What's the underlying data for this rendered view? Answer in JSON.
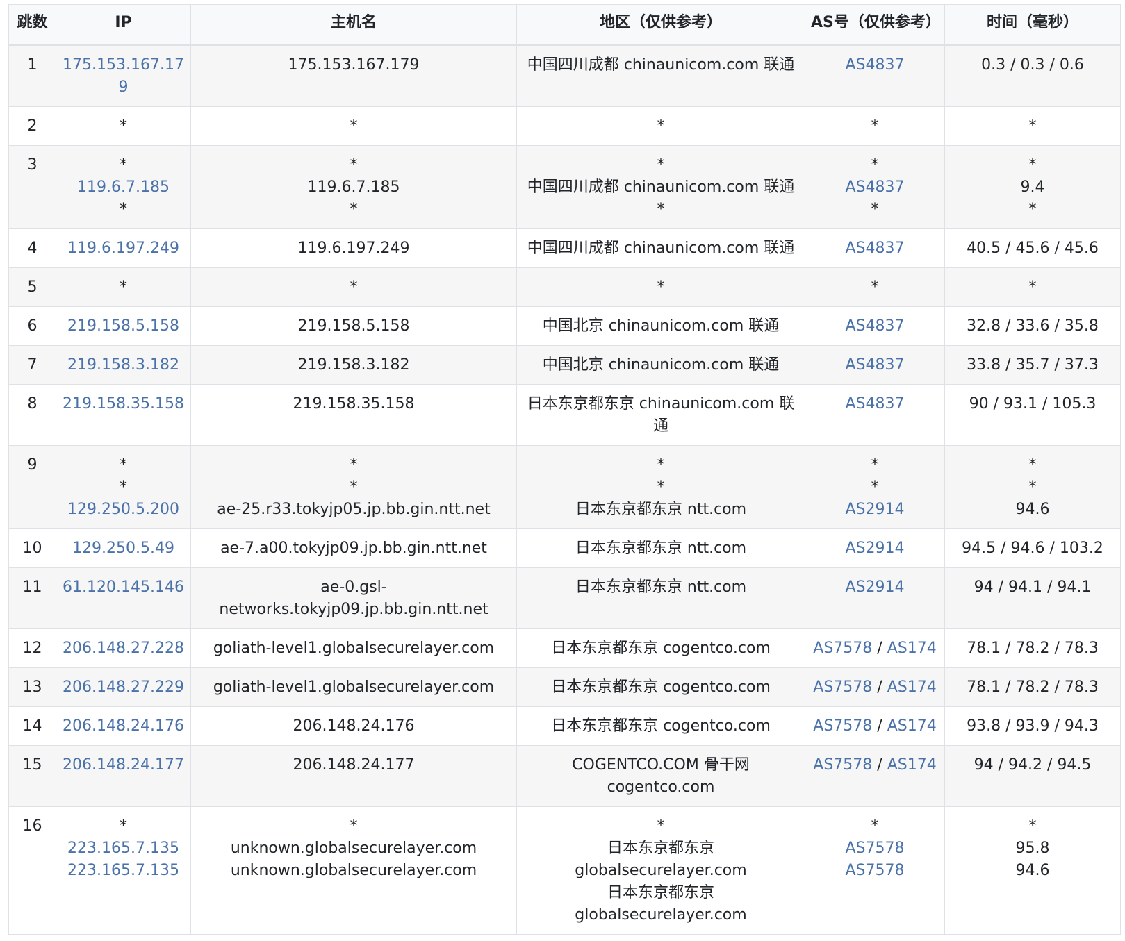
{
  "headers": {
    "hop": "跳数",
    "ip": "IP",
    "host": "主机名",
    "region": "地区（仅供参考）",
    "asn": "AS号（仅供参考）",
    "time": "时间（毫秒）"
  },
  "colors": {
    "link": "#4a72a9",
    "border": "#dee2e6",
    "stripe": "#f6f6f6"
  },
  "rows": [
    {
      "hop": "1",
      "ip": [
        "175.153.167.179"
      ],
      "host": [
        "175.153.167.179"
      ],
      "region": [
        "中国四川成都 chinaunicom.com 联通"
      ],
      "asn": [
        [
          "AS4837"
        ]
      ],
      "time": [
        "0.3 / 0.3 / 0.6"
      ]
    },
    {
      "hop": "2",
      "ip": [
        "*"
      ],
      "host": [
        "*"
      ],
      "region": [
        "*"
      ],
      "asn": [
        [
          "*"
        ]
      ],
      "time": [
        "*"
      ]
    },
    {
      "hop": "3",
      "ip": [
        "*",
        "119.6.7.185",
        "*"
      ],
      "host": [
        "*",
        "119.6.7.185",
        "*"
      ],
      "region": [
        "*",
        "中国四川成都 chinaunicom.com 联通",
        "*"
      ],
      "asn": [
        [
          "*"
        ],
        [
          "AS4837"
        ],
        [
          "*"
        ]
      ],
      "time": [
        "*",
        "9.4",
        "*"
      ]
    },
    {
      "hop": "4",
      "ip": [
        "119.6.197.249"
      ],
      "host": [
        "119.6.197.249"
      ],
      "region": [
        "中国四川成都 chinaunicom.com 联通"
      ],
      "asn": [
        [
          "AS4837"
        ]
      ],
      "time": [
        "40.5 / 45.6 / 45.6"
      ]
    },
    {
      "hop": "5",
      "ip": [
        "*"
      ],
      "host": [
        "*"
      ],
      "region": [
        "*"
      ],
      "asn": [
        [
          "*"
        ]
      ],
      "time": [
        "*"
      ]
    },
    {
      "hop": "6",
      "ip": [
        "219.158.5.158"
      ],
      "host": [
        "219.158.5.158"
      ],
      "region": [
        "中国北京 chinaunicom.com 联通"
      ],
      "asn": [
        [
          "AS4837"
        ]
      ],
      "time": [
        "32.8 / 33.6 / 35.8"
      ]
    },
    {
      "hop": "7",
      "ip": [
        "219.158.3.182"
      ],
      "host": [
        "219.158.3.182"
      ],
      "region": [
        "中国北京 chinaunicom.com 联通"
      ],
      "asn": [
        [
          "AS4837"
        ]
      ],
      "time": [
        "33.8 / 35.7 / 37.3"
      ]
    },
    {
      "hop": "8",
      "ip": [
        "219.158.35.158"
      ],
      "host": [
        "219.158.35.158"
      ],
      "region": [
        "日本东京都东京 chinaunicom.com 联通"
      ],
      "asn": [
        [
          "AS4837"
        ]
      ],
      "time": [
        "90 / 93.1 / 105.3"
      ]
    },
    {
      "hop": "9",
      "ip": [
        "*",
        "*",
        "129.250.5.200"
      ],
      "host": [
        "*",
        "*",
        "ae-25.r33.tokyjp05.jp.bb.gin.ntt.net"
      ],
      "region": [
        "*",
        "*",
        "日本东京都东京 ntt.com"
      ],
      "asn": [
        [
          "*"
        ],
        [
          "*"
        ],
        [
          "AS2914"
        ]
      ],
      "time": [
        "*",
        "*",
        "94.6"
      ]
    },
    {
      "hop": "10",
      "ip": [
        "129.250.5.49"
      ],
      "host": [
        "ae-7.a00.tokyjp09.jp.bb.gin.ntt.net"
      ],
      "region": [
        "日本东京都东京 ntt.com"
      ],
      "asn": [
        [
          "AS2914"
        ]
      ],
      "time": [
        "94.5 / 94.6 / 103.2"
      ]
    },
    {
      "hop": "11",
      "ip": [
        "61.120.145.146"
      ],
      "host": [
        "ae-0.gsl-networks.tokyjp09.jp.bb.gin.ntt.net"
      ],
      "region": [
        "日本东京都东京 ntt.com"
      ],
      "asn": [
        [
          "AS2914"
        ]
      ],
      "time": [
        "94 / 94.1 / 94.1"
      ]
    },
    {
      "hop": "12",
      "ip": [
        "206.148.27.228"
      ],
      "host": [
        "goliath-level1.globalsecurelayer.com"
      ],
      "region": [
        "日本东京都东京 cogentco.com"
      ],
      "asn": [
        [
          "AS7578",
          "AS174"
        ]
      ],
      "time": [
        "78.1 / 78.2 / 78.3"
      ]
    },
    {
      "hop": "13",
      "ip": [
        "206.148.27.229"
      ],
      "host": [
        "goliath-level1.globalsecurelayer.com"
      ],
      "region": [
        "日本东京都东京 cogentco.com"
      ],
      "asn": [
        [
          "AS7578",
          "AS174"
        ]
      ],
      "time": [
        "78.1 / 78.2 / 78.3"
      ]
    },
    {
      "hop": "14",
      "ip": [
        "206.148.24.176"
      ],
      "host": [
        "206.148.24.176"
      ],
      "region": [
        "日本东京都东京 cogentco.com"
      ],
      "asn": [
        [
          "AS7578",
          "AS174"
        ]
      ],
      "time": [
        "93.8 / 93.9 / 94.3"
      ]
    },
    {
      "hop": "15",
      "ip": [
        "206.148.24.177"
      ],
      "host": [
        "206.148.24.177"
      ],
      "region": [
        "COGENTCO.COM 骨干网 cogentco.com"
      ],
      "asn": [
        [
          "AS7578",
          "AS174"
        ]
      ],
      "time": [
        "94 / 94.2 / 94.5"
      ]
    },
    {
      "hop": "16",
      "ip": [
        "*",
        "223.165.7.135",
        "223.165.7.135"
      ],
      "host": [
        "*",
        "unknown.globalsecurelayer.com",
        "unknown.globalsecurelayer.com"
      ],
      "region": [
        "*",
        "日本东京都东京 globalsecurelayer.com",
        "日本东京都东京 globalsecurelayer.com"
      ],
      "asn": [
        [
          "*"
        ],
        [
          "AS7578"
        ],
        [
          "AS7578"
        ]
      ],
      "time": [
        "*",
        "95.8",
        "94.6"
      ]
    }
  ]
}
